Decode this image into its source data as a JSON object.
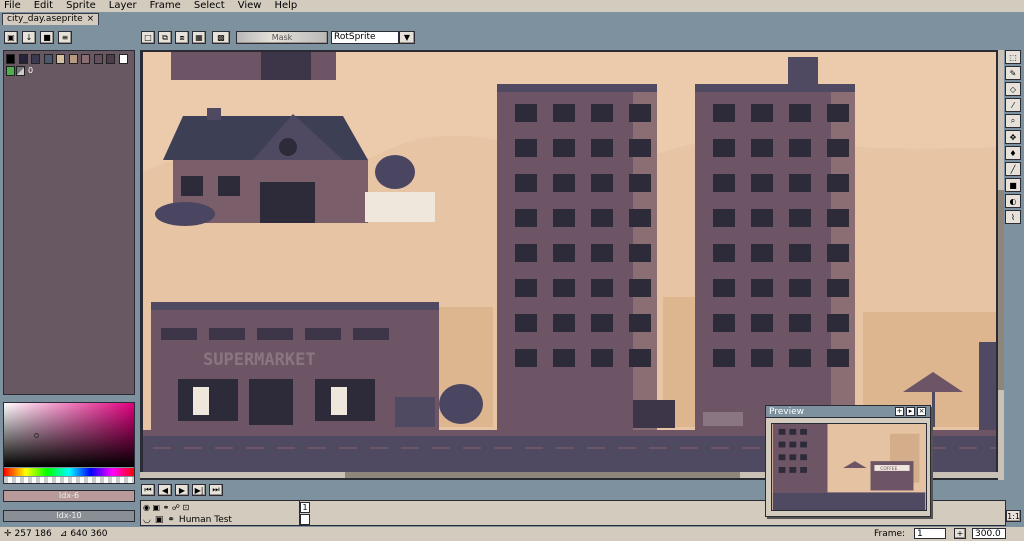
{
  "menu": [
    "File",
    "Edit",
    "Sprite",
    "Layer",
    "Frame",
    "Select",
    "View",
    "Help"
  ],
  "tab": {
    "title": "city_day.aseprite",
    "close": "×"
  },
  "toolbar": {
    "mask_label": "Mask",
    "rotation_algorithm": "RotSprite"
  },
  "palette": {
    "colors": [
      "#000000",
      "#26243a",
      "#3b3a53",
      "#4b5870",
      "#d7bfa2",
      "#b89a80",
      "#8a6e74",
      "#67505e",
      "#4e3b4c",
      "#ffffff",
      "#86242b",
      "#4caf50"
    ],
    "index_label": "0"
  },
  "color_bars": {
    "fg_label": "Idx-6",
    "bg_label": "Idx-10",
    "fg_color": "#b89a9a",
    "bg_color": "#8a8f95"
  },
  "scene": {
    "supermarket_sign": "SUPERMARKET",
    "coffee_sign": "COFFEE"
  },
  "preview": {
    "title": "Preview"
  },
  "layers": [
    {
      "name": "Human Test"
    }
  ],
  "frames": {
    "current_frame": "1",
    "frame_label": "Frame:",
    "frame_value": "1",
    "zoom_value": "300.0"
  },
  "status": {
    "cursor": "257 186",
    "size": "640 360"
  },
  "zoom_button": "1:1"
}
